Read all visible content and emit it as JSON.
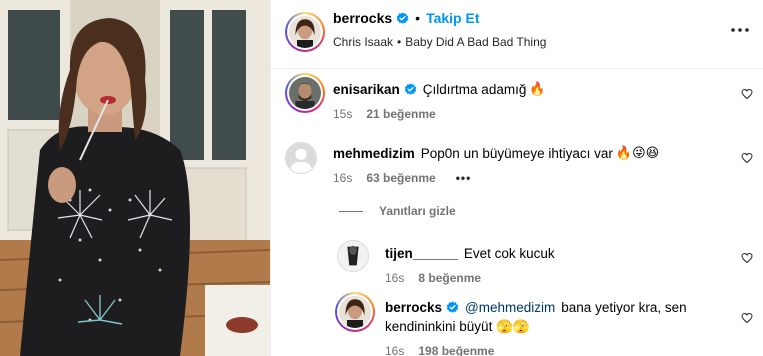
{
  "post_header": {
    "username": "berrocks",
    "separator": "•",
    "follow_label": "Takip Et",
    "artist": "Chris Isaak",
    "music_separator": "•",
    "song": "Baby Did A Bad Bad Thing"
  },
  "comments": [
    {
      "username": "enisarikan",
      "verified": true,
      "text": "Çıldırtma adamığ",
      "emojis": "🔥",
      "time": "15s",
      "likes": "21 beğenme"
    },
    {
      "username": "mehmedizim",
      "verified": false,
      "text": "Pop0n un büyümeye ihtiyacı var",
      "emojis": "🔥😜😆",
      "time": "16s",
      "likes": "63 beğenme",
      "more": "•••"
    }
  ],
  "hide_replies_label": "Yanıtları gizle",
  "replies": [
    {
      "username": "tijen______",
      "verified": false,
      "text": "Evet cok kucuk",
      "time": "16s",
      "likes": "8 beğenme"
    },
    {
      "username": "berrocks",
      "verified": true,
      "mention": "@mehmedizim",
      "text_line1": "bana yetiyor kra, sen",
      "text_line2": "kendininkini büyüt 🫣🫣",
      "time": "16s",
      "likes": "198 beğenme"
    }
  ],
  "colors": {
    "accent_blue": "#0095f6",
    "mention_blue": "#00376b",
    "secondary_text": "#737373",
    "divider": "#efefef"
  },
  "icons": [
    "verified-badge-icon",
    "more-options-icon",
    "heart-icon"
  ]
}
